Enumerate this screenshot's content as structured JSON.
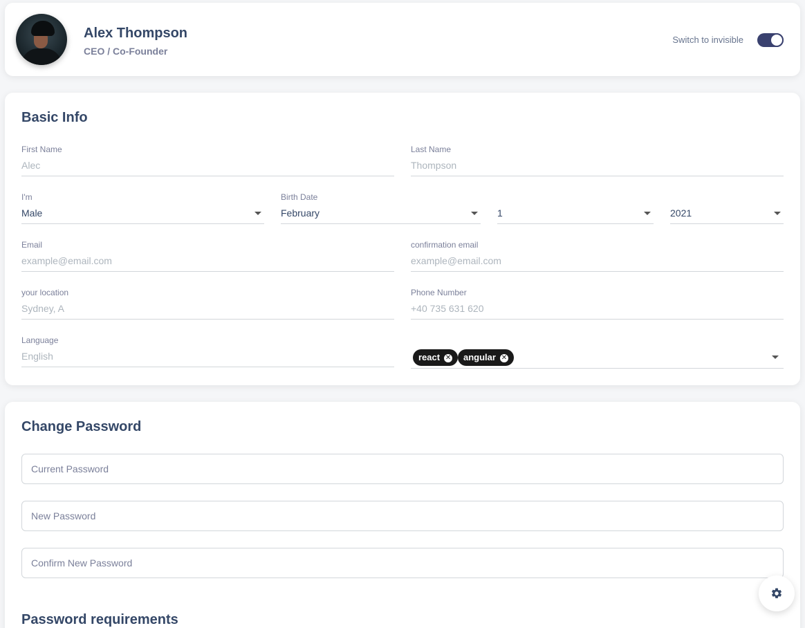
{
  "profile": {
    "name": "Alex Thompson",
    "role": "CEO / Co-Founder",
    "invisible_label": "Switch to invisible",
    "invisible_on": true
  },
  "basic_info": {
    "title": "Basic Info",
    "first_name": {
      "label": "First Name",
      "placeholder": "Alec"
    },
    "last_name": {
      "label": "Last Name",
      "placeholder": "Thompson"
    },
    "gender": {
      "label": "I'm",
      "value": "Male"
    },
    "birth_date": {
      "label": "Birth Date",
      "month": "February",
      "day": "1",
      "year": "2021"
    },
    "email": {
      "label": "Email",
      "placeholder": "example@email.com"
    },
    "confirm_email": {
      "label": "confirmation email",
      "placeholder": "example@email.com"
    },
    "location": {
      "label": "your location",
      "placeholder": "Sydney, A"
    },
    "phone": {
      "label": "Phone Number",
      "placeholder": "+40 735 631 620"
    },
    "language": {
      "label": "Language",
      "placeholder": "English"
    },
    "skills": [
      "react",
      "angular"
    ]
  },
  "change_password": {
    "title": "Change Password",
    "current_placeholder": "Current Password",
    "new_placeholder": "New Password",
    "confirm_placeholder": "Confirm New Password",
    "requirements_title": "Password requirements"
  },
  "icons": {
    "settings_fab": "gear-icon",
    "chip_remove": "close-circle-icon"
  },
  "colors": {
    "text_primary": "#344767",
    "text_secondary": "#7b809a",
    "toggle_on": "#3a416f",
    "chip_bg": "#1a1a1a"
  }
}
